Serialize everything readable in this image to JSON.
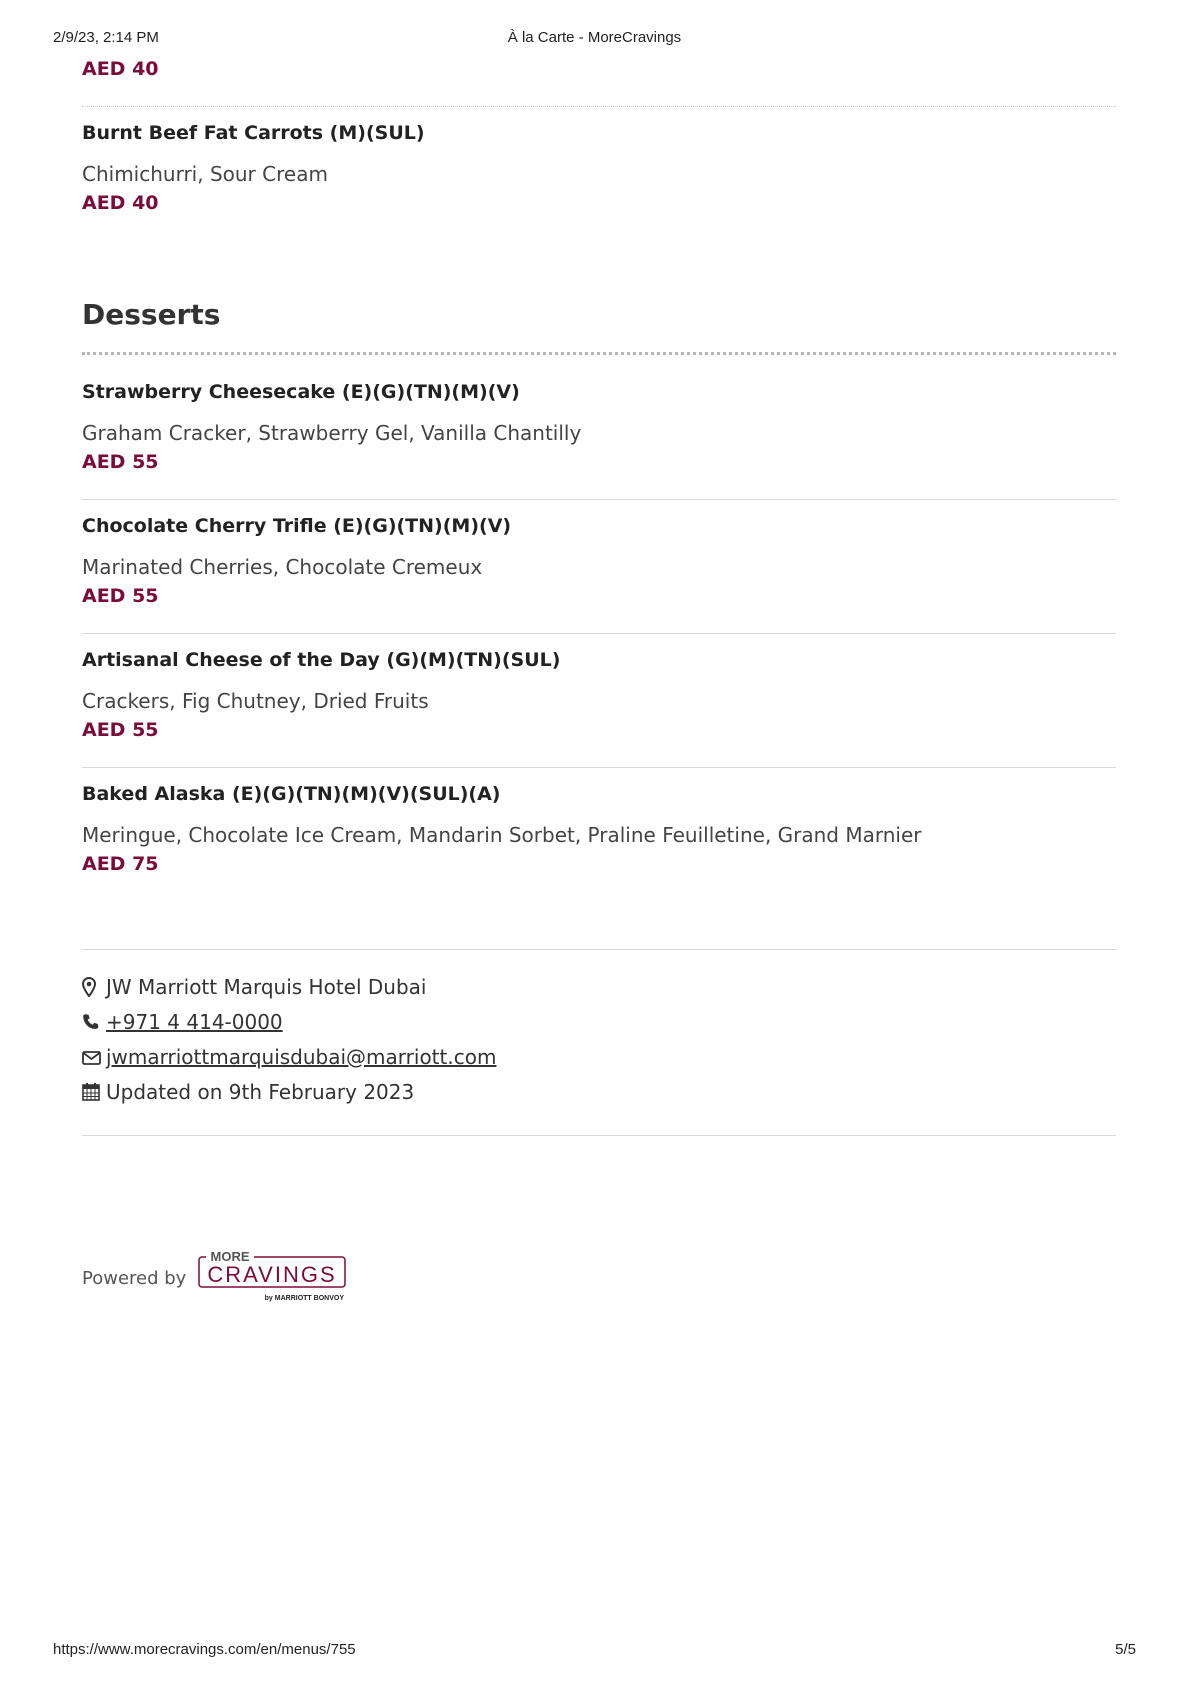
{
  "print_header": {
    "datetime": "2/9/23, 2:14 PM",
    "title": "À la Carte - MoreCravings"
  },
  "print_footer": {
    "url": "https://www.morecravings.com/en/menus/755",
    "page": "5/5"
  },
  "top_item": {
    "price": "AED 40"
  },
  "items_before": [
    {
      "name": "Burnt Beef Fat Carrots (M)(SUL)",
      "desc": "Chimichurri, Sour Cream",
      "price": "AED 40"
    }
  ],
  "desserts": {
    "title": "Desserts",
    "items": [
      {
        "name": "Strawberry Cheesecake (E)(G)(TN)(M)(V)",
        "desc": "Graham Cracker, Strawberry Gel, Vanilla Chantilly",
        "price": "AED 55"
      },
      {
        "name": "Chocolate Cherry Trifle (E)(G)(TN)(M)(V)",
        "desc": "Marinated Cherries, Chocolate Cremeux",
        "price": "AED 55"
      },
      {
        "name": "Artisanal Cheese of the Day (G)(M)(TN)(SUL)",
        "desc": "Crackers, Fig Chutney, Dried Fruits",
        "price": "AED 55"
      },
      {
        "name": "Baked Alaska (E)(G)(TN)(M)(V)(SUL)(A)",
        "desc": "Meringue, Chocolate Ice Cream, Mandarin Sorbet, Praline Feuilletine, Grand Marnier",
        "price": "AED 75"
      }
    ]
  },
  "contact": {
    "location": "JW Marriott Marquis Hotel Dubai",
    "phone": " +971 4 414-0000",
    "email": " jwmarriottmarquisdubai@marriott.com",
    "updated": "Updated on 9th February 2023"
  },
  "powered_by": {
    "label": "Powered by",
    "logo_top": "MORE",
    "logo_main": "CRAVINGS",
    "logo_sub": "by MARRIOTT BONVOY"
  },
  "colors": {
    "price": "#7a0c3a",
    "text": "#333333",
    "rule": "#d8d8d8"
  }
}
